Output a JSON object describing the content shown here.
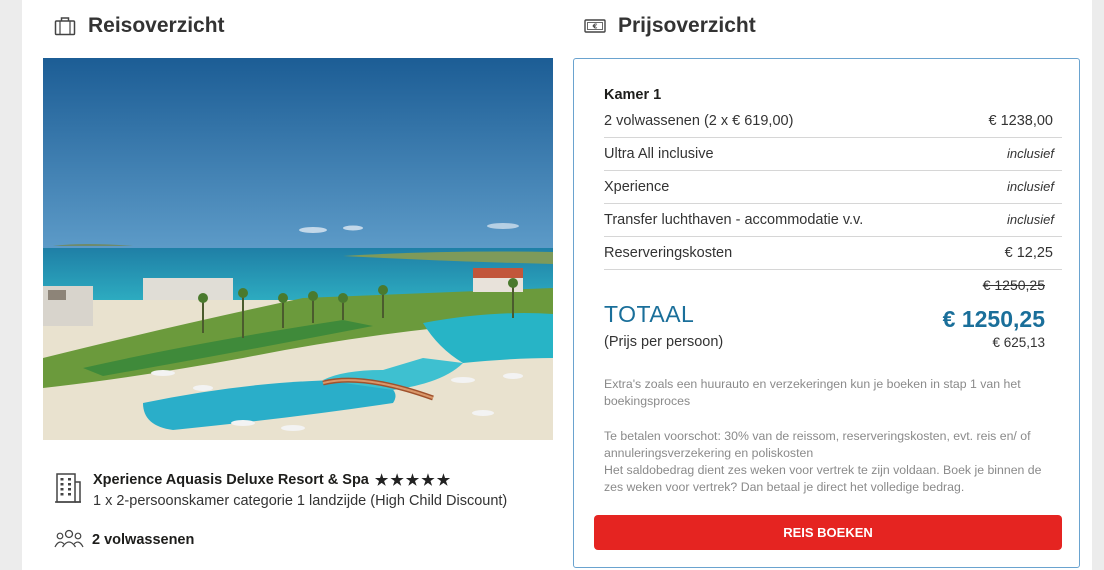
{
  "reisoverzicht": {
    "title": "Reisoverzicht",
    "title_icon": "suitcase-icon",
    "hotel_icon": "building-icon",
    "hotel_name": "Xperience Aquasis Deluxe Resort & Spa",
    "stars": 5,
    "room_description": "1 x 2-persoonskamer categorie 1 landzijde (High Child Discount)",
    "guests_icon": "people-icon",
    "guests": "2 volwassenen"
  },
  "prijsoverzicht": {
    "title": "Prijsoverzicht",
    "title_icon": "banknote-icon",
    "room_heading": "Kamer 1",
    "rows": [
      {
        "label": "2 volwassenen (2 x € 619,00)",
        "value": "€ 1238,00",
        "style": "amount"
      },
      {
        "label": "Ultra All inclusive",
        "value": "inclusief",
        "style": "included"
      },
      {
        "label": "Xperience",
        "value": "inclusief",
        "style": "included"
      },
      {
        "label": "Transfer luchthaven - accommodatie v.v.",
        "value": "inclusief",
        "style": "included"
      },
      {
        "label": "Reserveringskosten",
        "value": "€ 12,25",
        "style": "amount"
      }
    ],
    "old_total": "€ 1250,25",
    "total_label": "TOTAAL",
    "total_amount": "€ 1250,25",
    "per_person_label": "(Prijs per persoon)",
    "per_person_amount": "€ 625,13",
    "note_extras": "Extra's zoals een huurauto en verzekeringen kun je boeken in stap 1 van het boekingsproces",
    "note_payment_1": "Te betalen voorschot: 30% van de reissom, reserveringskosten, evt. reis en/ of annuleringsverzekering en poliskosten",
    "note_payment_2": "Het saldobedrag dient zes weken voor vertrek te zijn voldaan. Boek je binnen de zes weken voor vertrek? Dan betaal je direct het volledige bedrag.",
    "book_button": "REIS BOEKEN"
  },
  "colors": {
    "accent_blue": "#1a6f9a",
    "book_red": "#e52421",
    "box_border": "#6aa3cf"
  }
}
